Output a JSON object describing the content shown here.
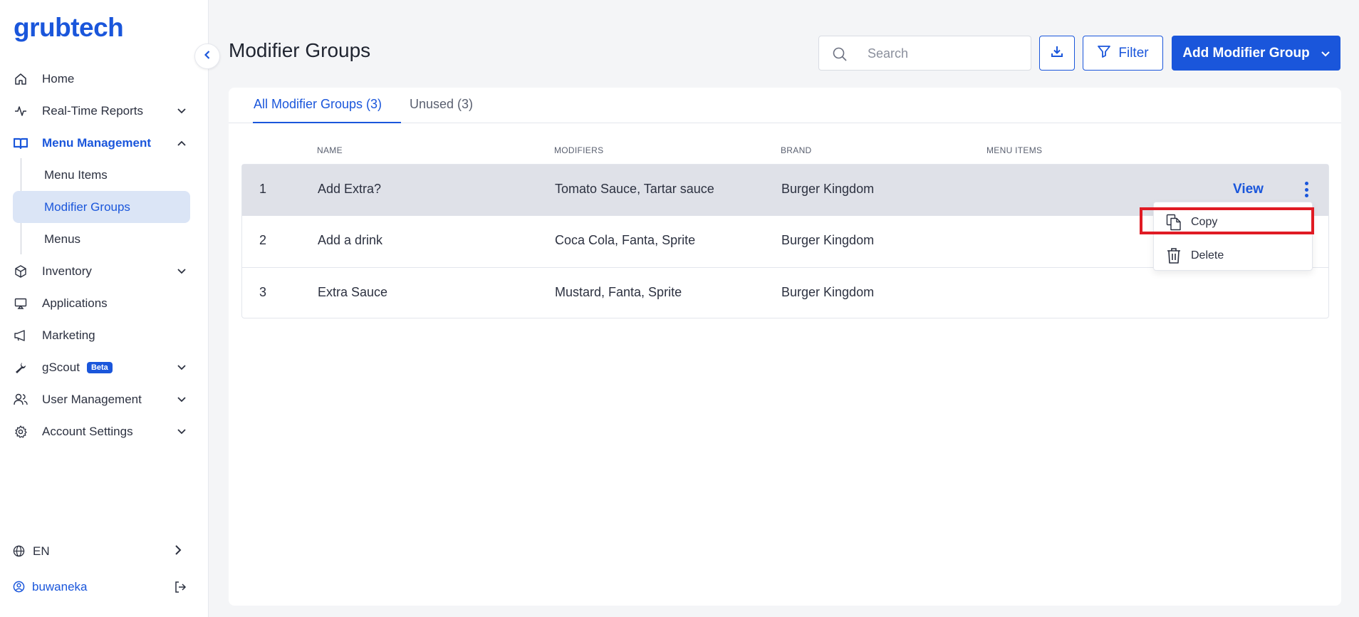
{
  "brand": {
    "logo_text": "grubtech",
    "accent": "#1a56db"
  },
  "sidebar": {
    "items": [
      {
        "label": "Home",
        "icon": "home-icon"
      },
      {
        "label": "Real-Time Reports",
        "icon": "activity-icon"
      },
      {
        "label": "Menu Management",
        "icon": "book-icon"
      },
      {
        "label": "Inventory",
        "icon": "box-icon"
      },
      {
        "label": "Applications",
        "icon": "monitor-icon"
      },
      {
        "label": "Marketing",
        "icon": "megaphone-icon"
      },
      {
        "label": "gScout",
        "icon": "wrench-icon",
        "badge": "Beta"
      },
      {
        "label": "User Management",
        "icon": "users-icon"
      },
      {
        "label": "Account Settings",
        "icon": "gear-icon"
      }
    ],
    "subitems": [
      {
        "label": "Menu Items"
      },
      {
        "label": "Modifier Groups"
      },
      {
        "label": "Menus"
      }
    ],
    "language": "EN",
    "username": "buwaneka"
  },
  "header": {
    "title": "Modifier Groups",
    "search_placeholder": "Search",
    "filter_label": "Filter",
    "add_label": "Add Modifier Group"
  },
  "tabs": [
    {
      "label": "All Modifier Groups (3)"
    },
    {
      "label": "Unused (3)"
    }
  ],
  "table": {
    "columns": [
      "NAME",
      "MODIFIERS",
      "BRAND",
      "MENU ITEMS"
    ],
    "rows": [
      {
        "index": "1",
        "name": "Add Extra?",
        "modifiers": "Tomato Sauce, Tartar sauce",
        "brand": "Burger Kingdom"
      },
      {
        "index": "2",
        "name": "Add a drink",
        "modifiers": "Coca Cola, Fanta, Sprite",
        "brand": "Burger Kingdom"
      },
      {
        "index": "3",
        "name": "Extra Sauce",
        "modifiers": "Mustard, Fanta, Sprite",
        "brand": "Burger Kingdom"
      }
    ],
    "view_label": "View"
  },
  "row_menu": {
    "copy_label": "Copy",
    "delete_label": "Delete"
  }
}
